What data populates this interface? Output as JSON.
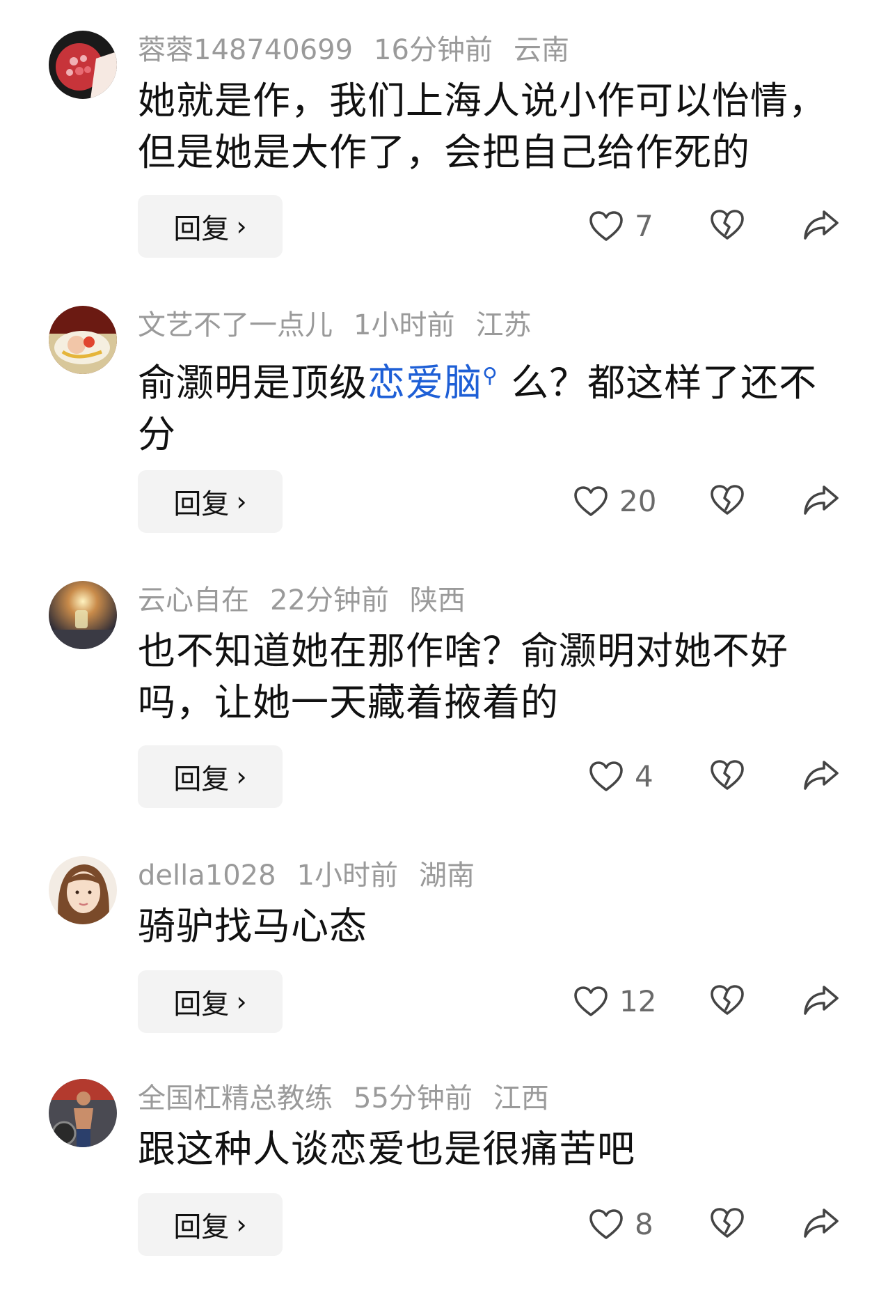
{
  "comments": [
    {
      "username": "蓉蓉148740699",
      "time": "16分钟前",
      "location": "云南",
      "text_lines": [
        "她就是作，我们上海人说小作可以怡情，",
        "但是她是大作了，会把自己给作死的"
      ],
      "likes": "7",
      "reply_label": "回复",
      "avatar_icon": "pomegranate-avatar"
    },
    {
      "username": "文艺不了一点儿",
      "time": "1小时前",
      "location": "江苏",
      "text_before_link": "俞灏明是顶级",
      "link_text": "恋爱脑",
      "text_after_link": "么？都这样了还不",
      "text_line2": "分",
      "likes": "20",
      "reply_label": "回复",
      "avatar_icon": "food-plate-avatar"
    },
    {
      "username": "云心自在",
      "time": "22分钟前",
      "location": "陕西",
      "text_lines": [
        "也不知道她在那作啥？俞灏明对她不好",
        "吗，让她一天藏着掖着的"
      ],
      "likes": "4",
      "reply_label": "回复",
      "avatar_icon": "sunset-glass-avatar"
    },
    {
      "username": "della1028",
      "time": "1小时前",
      "location": "湖南",
      "text_lines": [
        "骑驴找马心态"
      ],
      "likes": "12",
      "reply_label": "回复",
      "avatar_icon": "woman-portrait-avatar"
    },
    {
      "username": "全国杠精总教练",
      "time": "55分钟前",
      "location": "江西",
      "text_lines": [
        "跟这种人谈恋爱也是很痛苦吧"
      ],
      "likes": "8",
      "reply_label": "回复",
      "avatar_icon": "gym-man-avatar"
    }
  ],
  "colors": {
    "meta_gray": "#9a9a9a",
    "link_blue": "#1e5fd6",
    "button_bg": "#f3f3f3"
  }
}
